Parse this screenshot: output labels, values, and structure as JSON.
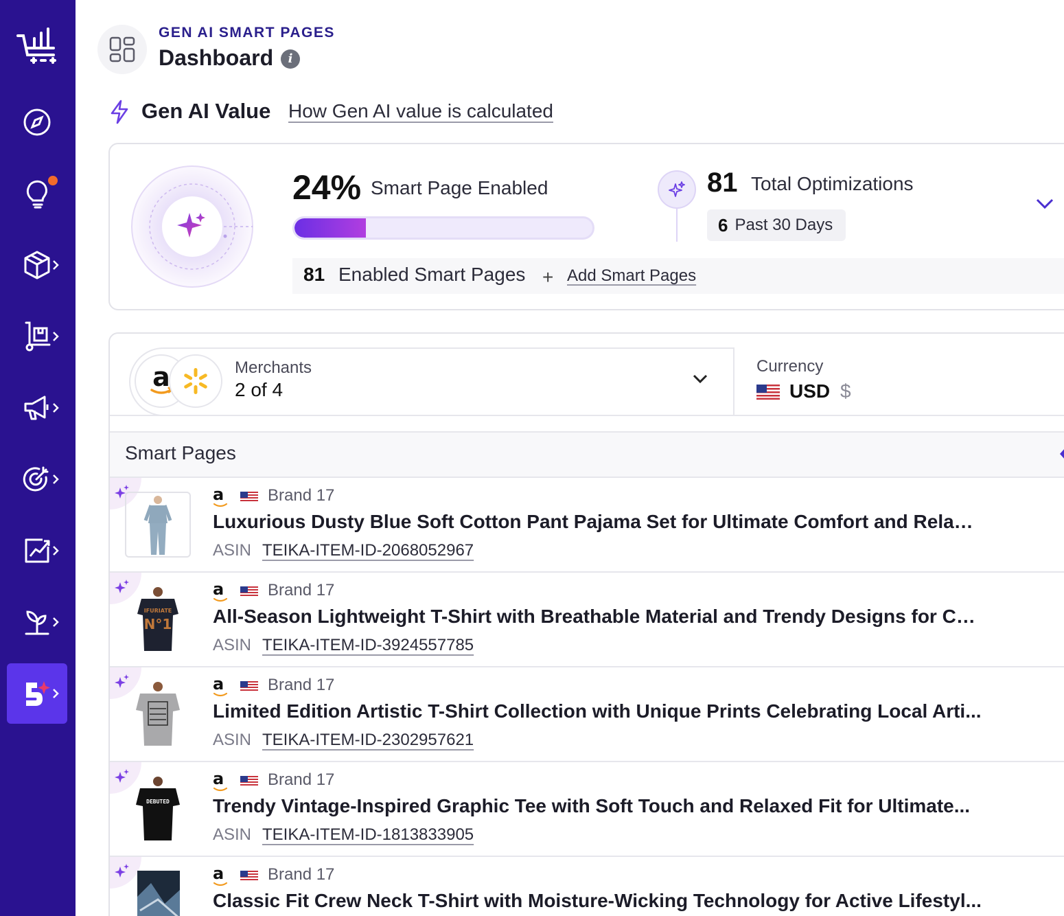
{
  "sidebar": {
    "items": [
      {
        "name": "analytics-cart",
        "icon": "cart-chart-icon"
      },
      {
        "name": "compass",
        "icon": "compass-icon"
      },
      {
        "name": "insights",
        "icon": "lightbulb-icon",
        "has_notification": true
      },
      {
        "name": "products",
        "icon": "box-icon"
      },
      {
        "name": "inventory",
        "icon": "hand-truck-icon"
      },
      {
        "name": "marketing",
        "icon": "megaphone-icon"
      },
      {
        "name": "targeting",
        "icon": "target-icon"
      },
      {
        "name": "reports",
        "icon": "chart-icon"
      },
      {
        "name": "growth",
        "icon": "sprout-icon"
      },
      {
        "name": "smart-pages",
        "icon": "smart-page-icon",
        "active": true
      }
    ]
  },
  "header": {
    "section": "GEN AI SMART PAGES",
    "title": "Dashboard"
  },
  "gen_ai_value": {
    "title": "Gen AI Value",
    "link": "How Gen AI value is calculated",
    "percent_text": "24%",
    "percent_value": 24,
    "percent_label": "Smart Page Enabled",
    "total_optimizations": "81",
    "total_optimizations_label": "Total Optimizations",
    "past_count": "6",
    "past_label": "Past 30 Days",
    "enabled_count": "81",
    "enabled_label": "Enabled Smart Pages",
    "add_label": "Add Smart Pages"
  },
  "filters": {
    "merchants_label": "Merchants",
    "merchants_value": "2 of 4",
    "currency_label": "Currency",
    "currency_value": "USD",
    "currency_symbol": "$"
  },
  "smart_pages": {
    "header": "Smart Pages",
    "asin_label": "ASIN",
    "rows": [
      {
        "brand": "Brand 17",
        "title": "Luxurious Dusty Blue Soft Cotton Pant Pajama Set for Ultimate Comfort and Relaxa...",
        "asin": "TEIKA-ITEM-ID-2068052967"
      },
      {
        "brand": "Brand 17",
        "title": "All-Season Lightweight T-Shirt with Breathable Material and Trendy Designs for Co...",
        "asin": "TEIKA-ITEM-ID-3924557785"
      },
      {
        "brand": "Brand 17",
        "title": "Limited Edition Artistic T-Shirt Collection with Unique Prints Celebrating Local Arti...",
        "asin": "TEIKA-ITEM-ID-2302957621"
      },
      {
        "brand": "Brand 17",
        "title": "Trendy Vintage-Inspired Graphic Tee with Soft Touch and Relaxed Fit for Ultimate...",
        "asin": "TEIKA-ITEM-ID-1813833905"
      },
      {
        "brand": "Brand 17",
        "title": "Classic Fit Crew Neck T-Shirt with Moisture-Wicking Technology for Active Lifestyl...",
        "asin": ""
      }
    ]
  },
  "colors": {
    "sidebar_bg": "#2a1290",
    "sidebar_active": "#5b35ea",
    "accent_purple": "#7b3fe4",
    "notification": "#f26b2b"
  }
}
